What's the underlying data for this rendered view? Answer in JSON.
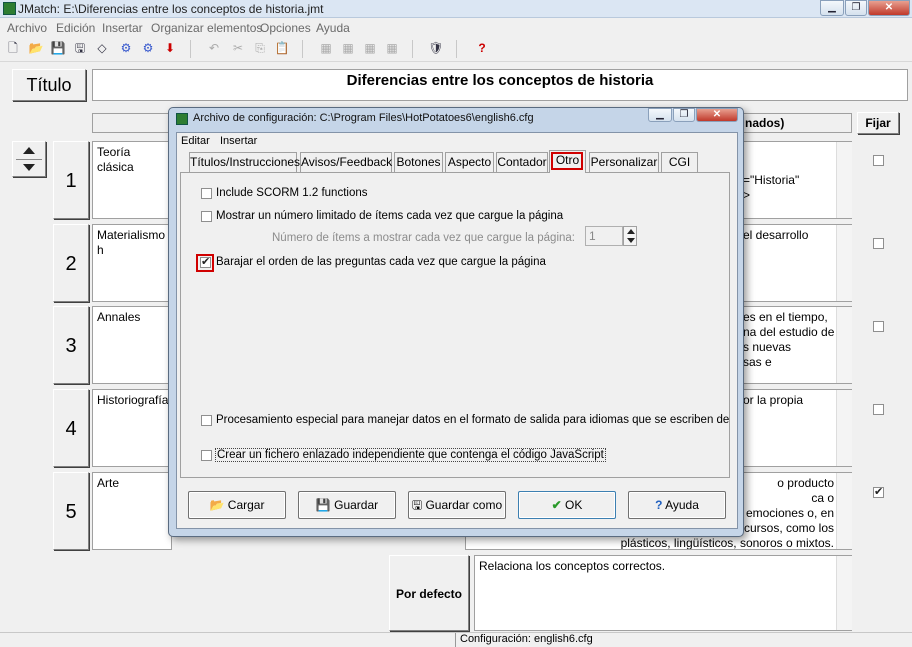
{
  "window": {
    "title": "JMatch: E:\\Diferencias entre los conceptos de historia.jmt"
  },
  "menu": [
    "Archivo",
    "Edición",
    "Insertar",
    "Organizar elementos",
    "Opciones",
    "Ayuda"
  ],
  "toolbar_icons": [
    "new-icon",
    "open-icon",
    "save-icon",
    "save-as-icon",
    "eraser-icon",
    "web-page-icon",
    "drag-drop-page-icon",
    "export-icon",
    "undo-icon",
    "cut-icon",
    "copy-icon",
    "paste-icon",
    "grid-icon",
    "grid2-icon",
    "grid3-icon",
    "grid4-icon",
    "config-icon",
    "help-icon"
  ],
  "main": {
    "title_label": "Título",
    "title_value": "Diferencias entre los conceptos de historia",
    "col_right_header": "nados)",
    "fijar": "Fijar",
    "rows": [
      {
        "num": "1",
        "left": "Teoría clásica",
        "right": "=\"Historia\"\n>"
      },
      {
        "num": "2",
        "left": "Materialismo h",
        "right": "el desarrollo"
      },
      {
        "num": "3",
        "left": "Annales",
        "right": "es en el tiempo,\nna del estudio de\ns nuevas\nsas e"
      },
      {
        "num": "4",
        "left": "Historiografía",
        "right": "or la propia"
      },
      {
        "num": "5",
        "left": "Arte",
        "right": "o producto\nca o\nemociones o, en\ncursos, como los\nplásticos, lingüísticos, sonoros o mixtos."
      }
    ],
    "fijar_checked": [
      false,
      false,
      false,
      false,
      true
    ],
    "default_label": "Por defecto",
    "default_value": "Relaciona los conceptos correctos."
  },
  "status": {
    "text": "Configuración: english6.cfg"
  },
  "dialog": {
    "title": "Archivo de configuración: C:\\Program Files\\HotPotatoes6\\english6.cfg",
    "menu": [
      "Editar",
      "Insertar"
    ],
    "tabs": [
      "Títulos/Instrucciones",
      "Avisos/Feedback",
      "Botones",
      "Aspecto",
      "Contador",
      "Otro",
      "Personalizar",
      "CGI"
    ],
    "active_tab": "Otro",
    "options": {
      "scorm": "Include SCORM 1.2 functions",
      "limited": "Mostrar un número limitado de ítems cada vez que cargue la página",
      "num_items_label": "Número de ítems a mostrar cada vez que cargue la página:",
      "num_items_value": "1",
      "shuffle": "Barajar el orden de las preguntas cada vez que cargue la página",
      "rtl": "Procesamiento especial para manejar datos en el formato de salida para idiomas que se escriben de",
      "separate_js": "Crear un fichero enlazado independiente que contenga el código JavaScript"
    },
    "buttons": {
      "load": "Cargar",
      "save": "Guardar",
      "save_as": "Guardar como",
      "ok": "OK",
      "help": "Ayuda"
    }
  }
}
